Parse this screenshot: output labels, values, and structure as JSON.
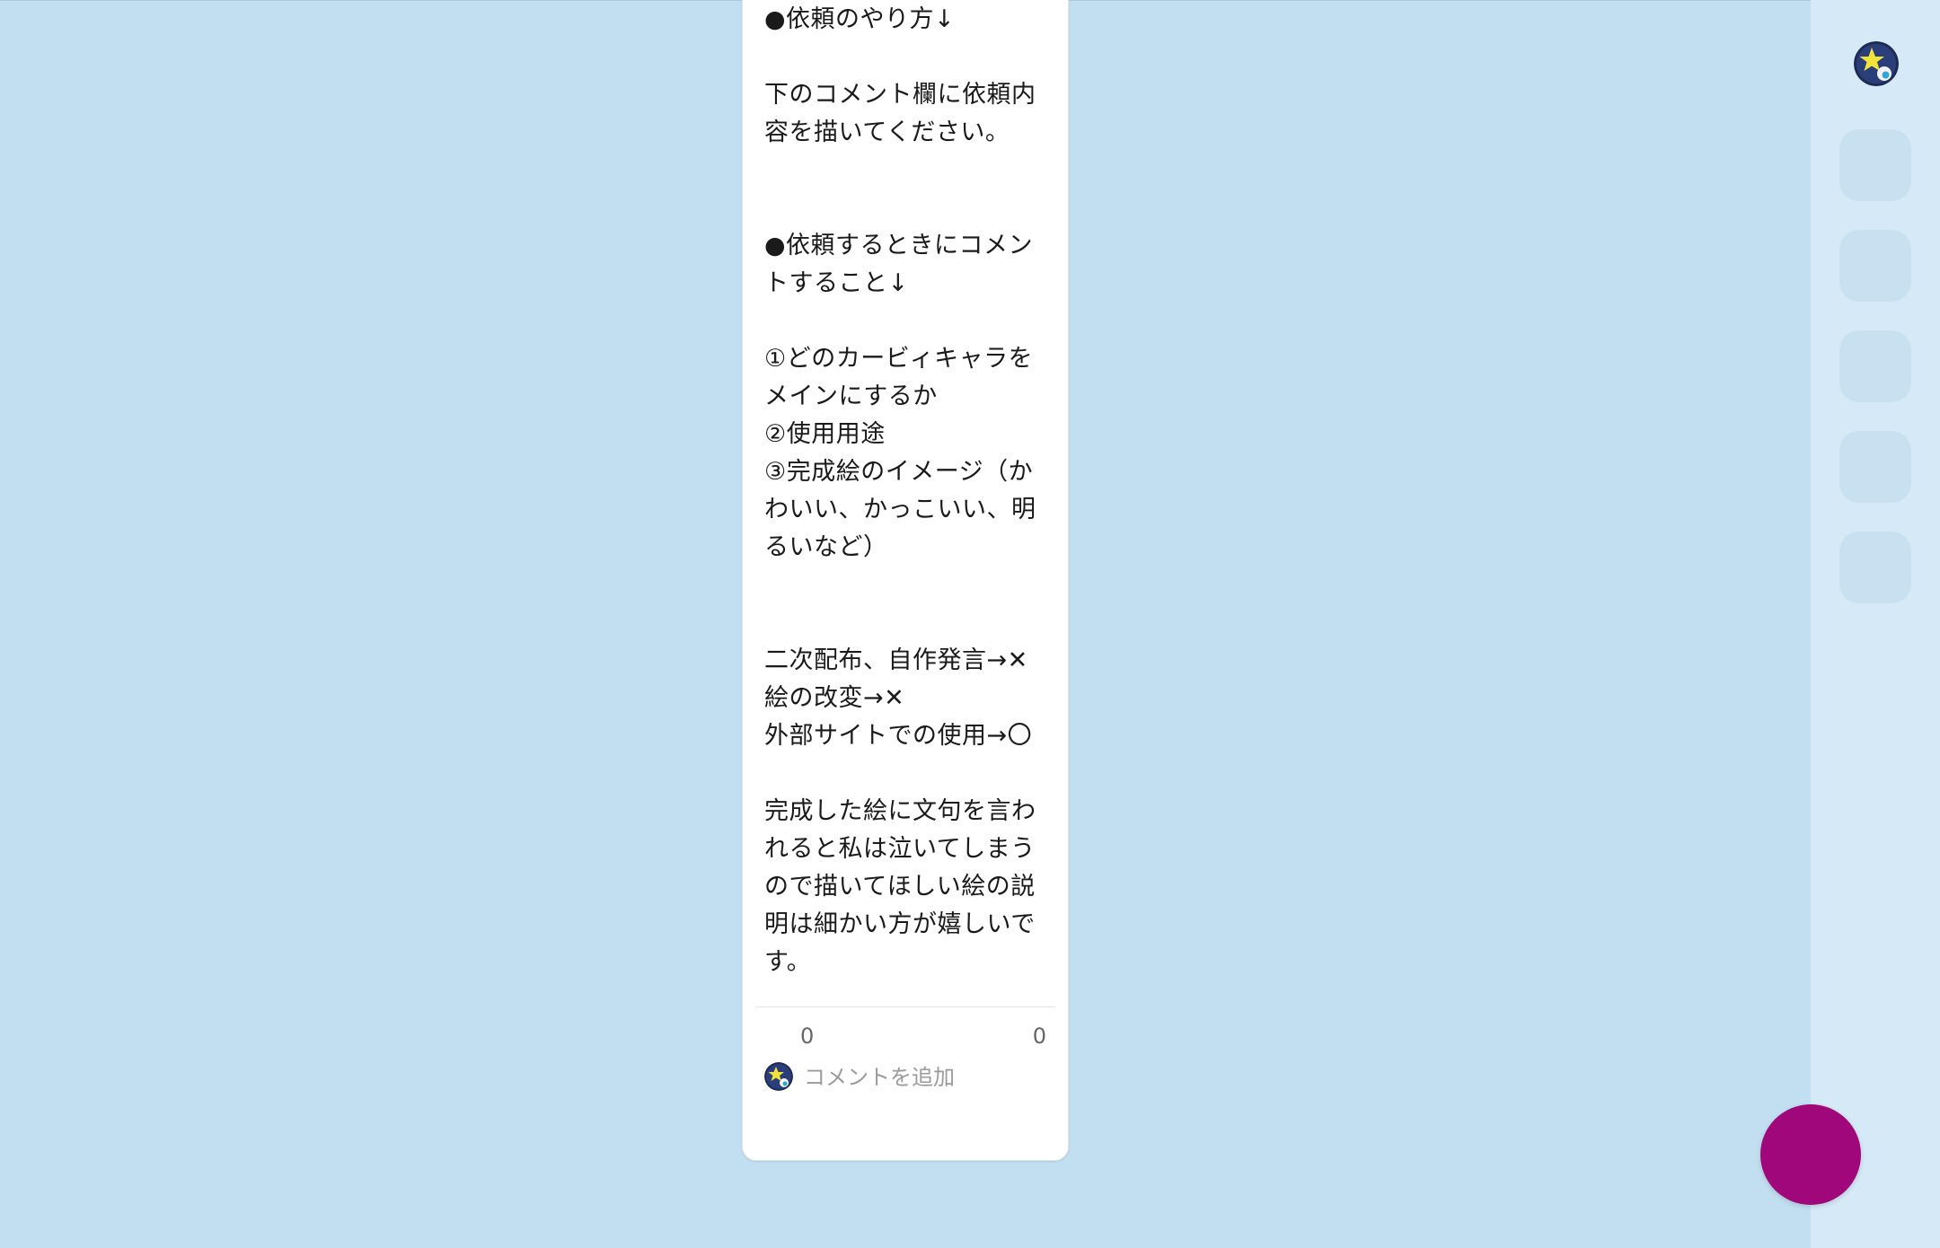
{
  "post": {
    "body": "●依頼のやり方↓\n\n下のコメント欄に依頼内容を描いてください。\n\n\n●依頼するときにコメントすること↓\n\n①どのカービィキャラをメインにするか\n②使用用途\n③完成絵のイメージ（かわいい、かっこいい、明るいなど）\n\n\n二次配布、自作発言→✕\n絵の改変→✕\n外部サイトでの使用→〇\n\n完成した絵に文句を言われると私は泣いてしまうので描いてほしい絵の説明は細かい方が嬉しいです。",
    "stat_left": "0",
    "stat_right": "0"
  },
  "comment": {
    "placeholder": "コメントを追加",
    "avatar_icon": "user-avatar-icon"
  },
  "right_rail": {
    "avatar_icon": "profile-avatar-icon",
    "slots": [
      "",
      "",
      "",
      "",
      ""
    ]
  },
  "fab": {
    "icon": "create-post-icon",
    "color": "#a0077a"
  },
  "colors": {
    "background": "#c2dff2",
    "rail": "#d5e9f7",
    "card": "#ffffff"
  }
}
